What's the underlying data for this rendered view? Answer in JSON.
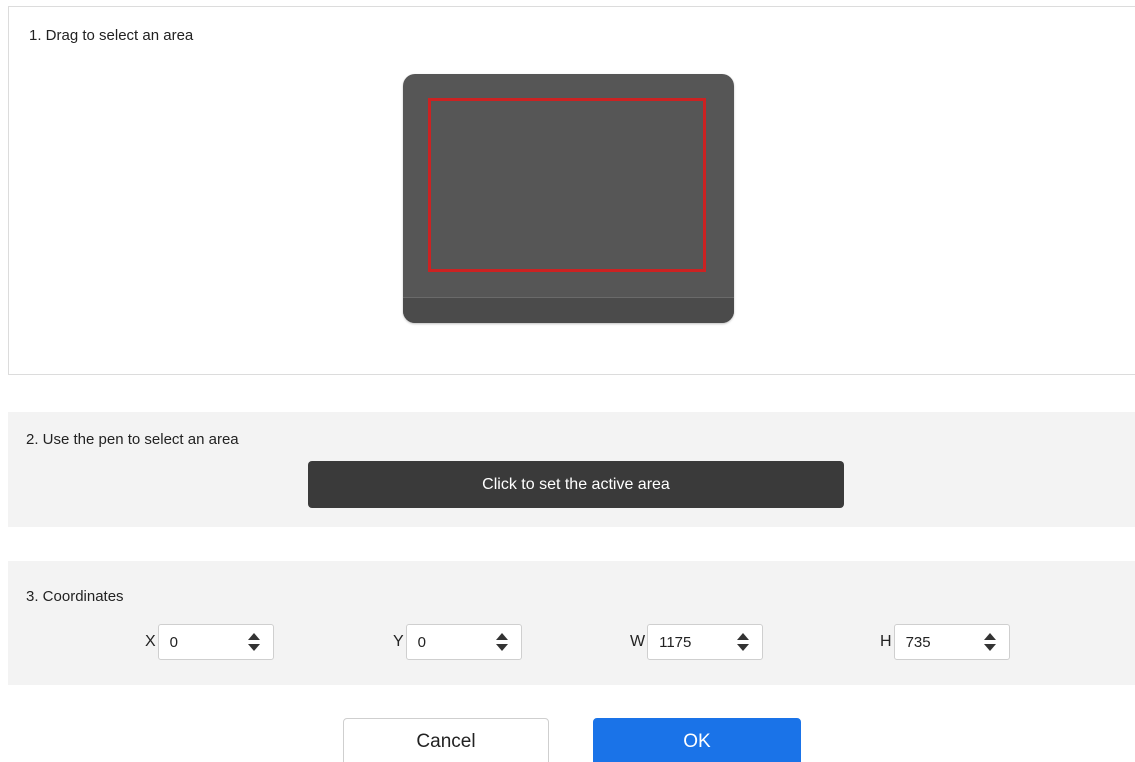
{
  "section1": {
    "title": "1. Drag to select an area",
    "tablet_color": "#565656",
    "selection_color": "#cc2222"
  },
  "section2": {
    "title": "2. Use the pen to select an area",
    "button_label": "Click to set the active area"
  },
  "section3": {
    "title": "3. Coordinates",
    "fields": [
      {
        "label": "X",
        "value": "0"
      },
      {
        "label": "Y",
        "value": "0"
      },
      {
        "label": "W",
        "value": "1175"
      },
      {
        "label": "H",
        "value": "735"
      }
    ]
  },
  "footer": {
    "cancel_label": "Cancel",
    "ok_label": "OK",
    "ok_color": "#1a73e8"
  }
}
